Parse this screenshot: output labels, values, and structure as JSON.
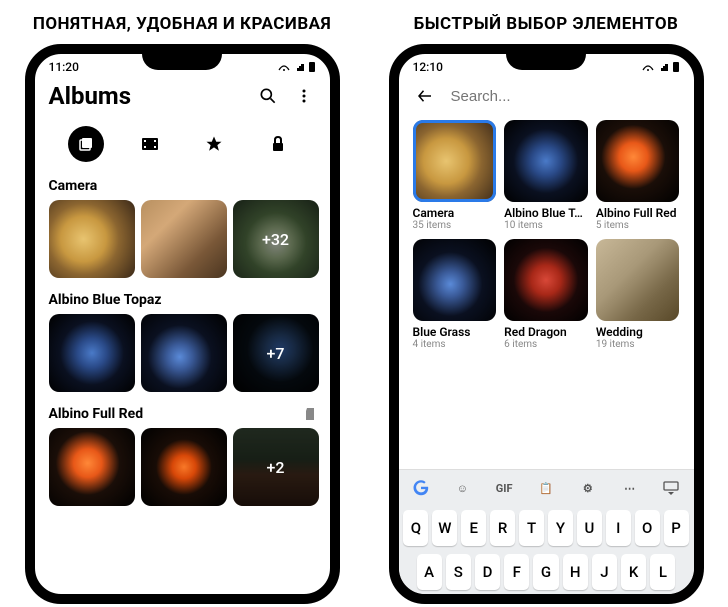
{
  "headings": {
    "left": "ПОНЯТНАЯ, УДОБНАЯ И КРАСИВАЯ",
    "right": "БЫСТРЫЙ ВЫБОР ЭЛЕМЕНТОВ"
  },
  "left": {
    "time": "11:20",
    "title": "Albums",
    "sections": [
      {
        "title": "Camera",
        "thumbs": [
          "food1",
          "food2",
          "food3"
        ],
        "overlay": "+32"
      },
      {
        "title": "Albino Blue Topaz",
        "thumbs": [
          "fish-blue",
          "fish-blue2",
          "fish-blue3"
        ],
        "overlay": "+7"
      },
      {
        "title": "Albino Full Red",
        "thumbs": [
          "fish-orange",
          "fish-orange2",
          "fish-orange3"
        ],
        "overlay": "+2",
        "sdIcon": true
      }
    ]
  },
  "right": {
    "time": "12:10",
    "searchPlaceholder": "Search...",
    "cards": [
      {
        "title": "Camera",
        "sub": "35 items",
        "cls": "food1",
        "selected": true
      },
      {
        "title": "Albino Blue T…",
        "sub": "10 items",
        "cls": "fish-blue"
      },
      {
        "title": "Albino Full Red",
        "sub": "5 items",
        "cls": "fish-orange"
      },
      {
        "title": "Blue Grass",
        "sub": "4 items",
        "cls": "fish-blue2"
      },
      {
        "title": "Red Dragon",
        "sub": "6 items",
        "cls": "fish-red"
      },
      {
        "title": "Wedding",
        "sub": "19 items",
        "cls": "wedding"
      }
    ],
    "keyboard": {
      "topLabels": [
        "G",
        "☺",
        "GIF",
        "📋",
        "⚙",
        "⋯",
        "↓"
      ],
      "row1": [
        "Q",
        "W",
        "E",
        "R",
        "T",
        "Y",
        "U",
        "I",
        "O",
        "P"
      ],
      "row2": [
        "A",
        "S",
        "D",
        "F",
        "G",
        "H",
        "J",
        "K",
        "L"
      ]
    }
  }
}
